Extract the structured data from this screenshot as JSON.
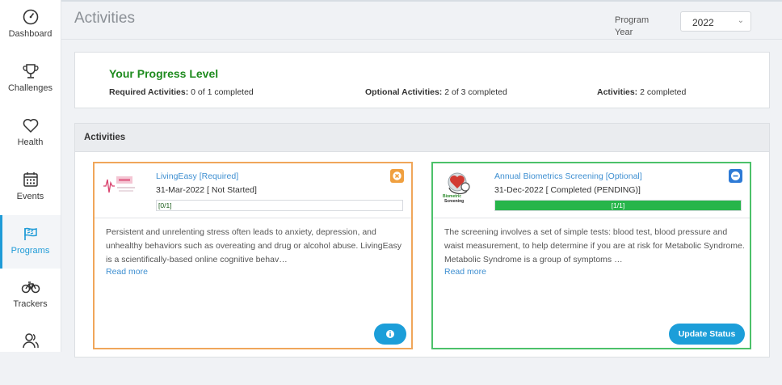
{
  "sidebar": {
    "items": [
      {
        "label": "Dashboard",
        "icon": "gauge-icon"
      },
      {
        "label": "Challenges",
        "icon": "trophy-icon"
      },
      {
        "label": "Health",
        "icon": "heart-icon"
      },
      {
        "label": "Events",
        "icon": "calendar-icon"
      },
      {
        "label": "Programs",
        "icon": "flag-icon",
        "active": true
      },
      {
        "label": "Trackers",
        "icon": "bicycle-icon"
      },
      {
        "label": "",
        "icon": "people-icon"
      }
    ]
  },
  "header": {
    "title": "Activities",
    "program_year_label": "Program Year",
    "program_year_value": "2022"
  },
  "progress": {
    "title": "Your Progress Level",
    "required_label": "Required Activities:",
    "required_value": "0 of 1 completed",
    "optional_label": "Optional Activities:",
    "optional_value": "2 of 3 completed",
    "activities_label": "Activities:",
    "activities_value": "2 completed"
  },
  "activities_panel": {
    "heading": "Activities",
    "cards": [
      {
        "title": "LivingEasy [Required]",
        "date_status": "31-Mar-2022 [ Not Started]",
        "progress_text": "[0/1]",
        "progress_fraction": 0,
        "description": "Persistent and unrelenting stress often leads to anxiety, depression, and unhealthy behaviors such as overeating and drug or alcohol abuse. LivingEasy is a scientifically-based online cognitive behav…",
        "read_more": "Read more",
        "border_color": "#f0a65a",
        "status_color": "#f0a040",
        "status_icon": "close-x-icon",
        "button_icon": "info-icon"
      },
      {
        "title": "Annual Biometrics Screening [Optional]",
        "date_status": "31-Dec-2022 [ Completed (PENDING)]",
        "progress_text": "[1/1]",
        "progress_fraction": 1,
        "description": "The screening involves a set of simple tests: blood test, blood pressure and waist measurement, to help determine if you are at risk for Metabolic Syndrome. Metabolic Syndrome is a group of symptoms …",
        "read_more": "Read more",
        "border_color": "#4cc16a",
        "status_color": "#2e7bd6",
        "status_icon": "minus-circle-icon",
        "logo_text": "Biometric Screening",
        "button_label": "Update Status"
      }
    ]
  }
}
